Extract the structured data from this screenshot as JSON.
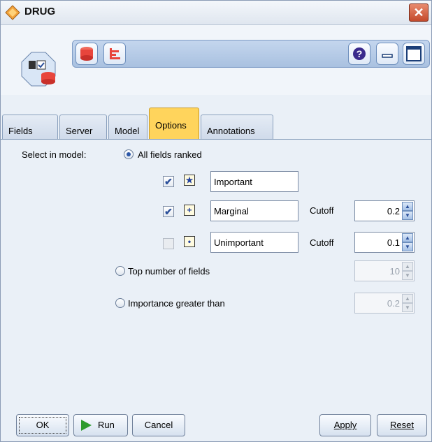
{
  "window": {
    "title": "DRUG",
    "close_label": "✕"
  },
  "toolbar": {
    "help_label": "?",
    "icons": [
      "database-icon",
      "chart-icon",
      "help-icon",
      "minimize-icon",
      "maximize-icon"
    ]
  },
  "tabs": [
    {
      "label": "Fields",
      "active": false
    },
    {
      "label": "Server",
      "active": false
    },
    {
      "label": "Model",
      "active": false
    },
    {
      "label": "Options",
      "active": true
    },
    {
      "label": "Annotations",
      "active": false
    }
  ],
  "options": {
    "select_label": "Select in model:",
    "all_ranked_label": "All fields ranked",
    "ranks": [
      {
        "checked": true,
        "symbol": "★",
        "name": "Important",
        "cutoff_label": "",
        "cutoff": ""
      },
      {
        "checked": true,
        "symbol": "+",
        "name": "Marginal",
        "cutoff_label": "Cutoff",
        "cutoff": "0.2"
      },
      {
        "checked": false,
        "symbol": "•",
        "name": "Unimportant",
        "cutoff_label": "Cutoff",
        "cutoff": "0.1"
      }
    ],
    "top_number_label": "Top number of fields",
    "top_number_value": "10",
    "importance_label": "Importance greater than",
    "importance_value": "0.2",
    "selected": "All fields ranked"
  },
  "buttons": {
    "ok": "OK",
    "run": "Run",
    "cancel": "Cancel",
    "apply": "Apply",
    "reset": "Reset"
  },
  "colors": {
    "active_tab": "#ffd45c",
    "accent": "#2b57a8"
  }
}
